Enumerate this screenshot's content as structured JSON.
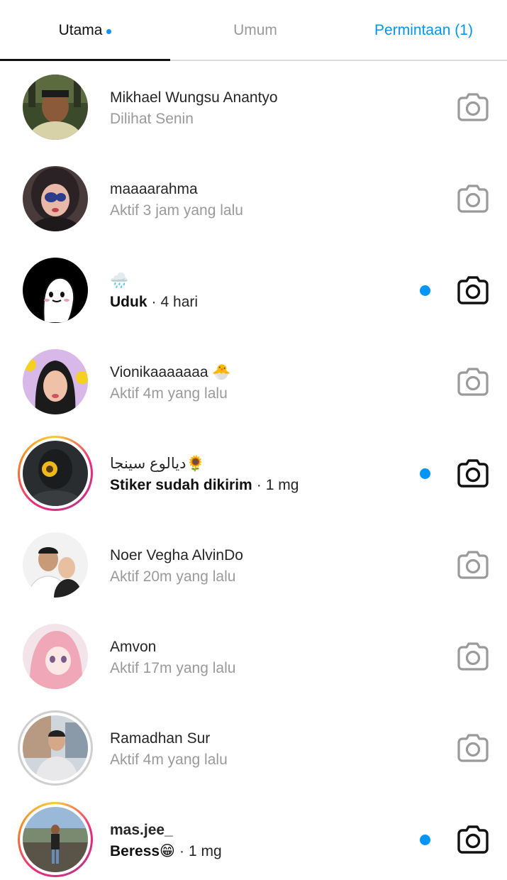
{
  "tabs": {
    "primary": "Utama",
    "general": "Umum",
    "requests": "Permintaan (1)"
  },
  "colors": {
    "accent": "#0095f6",
    "muted_text": "#9a9a9a",
    "icon_read": "#9a9a9a",
    "icon_unread": "#111111"
  },
  "threads": [
    {
      "name": "Mikhael Wungsu Anantyo",
      "status": "Dilihat Senin",
      "unread": false,
      "ring": "none",
      "camera_icon": "camera-icon"
    },
    {
      "name": "maaaarahma",
      "status": "Aktif 3 jam yang lalu",
      "unread": false,
      "ring": "none",
      "camera_icon": "camera-icon"
    },
    {
      "name": "🌧️",
      "message": "Uduk",
      "time": "4 hari",
      "unread": true,
      "ring": "none",
      "camera_icon": "camera-icon"
    },
    {
      "name": "Vionikaaaaaaa 🐣",
      "status": "Aktif 4m yang lalu",
      "unread": false,
      "ring": "none",
      "camera_icon": "camera-icon"
    },
    {
      "name": "ديالوع سينجا🌻",
      "message": "Stiker sudah dikirim",
      "time": "1 mg",
      "unread": true,
      "ring": "story",
      "camera_icon": "camera-icon"
    },
    {
      "name": "Noer Vegha AlvinDo",
      "status": "Aktif 20m yang lalu",
      "unread": false,
      "ring": "none",
      "camera_icon": "camera-icon"
    },
    {
      "name": "Amvon",
      "status": "Aktif 17m yang lalu",
      "unread": false,
      "ring": "none",
      "camera_icon": "camera-icon"
    },
    {
      "name": "Ramadhan Sur",
      "status": "Aktif 4m yang lalu",
      "unread": false,
      "ring": "seen",
      "camera_icon": "camera-icon"
    },
    {
      "name": "mas.jee_",
      "message": "Beress😁",
      "time": "1 mg",
      "unread": true,
      "ring": "story",
      "camera_icon": "camera-icon"
    }
  ]
}
